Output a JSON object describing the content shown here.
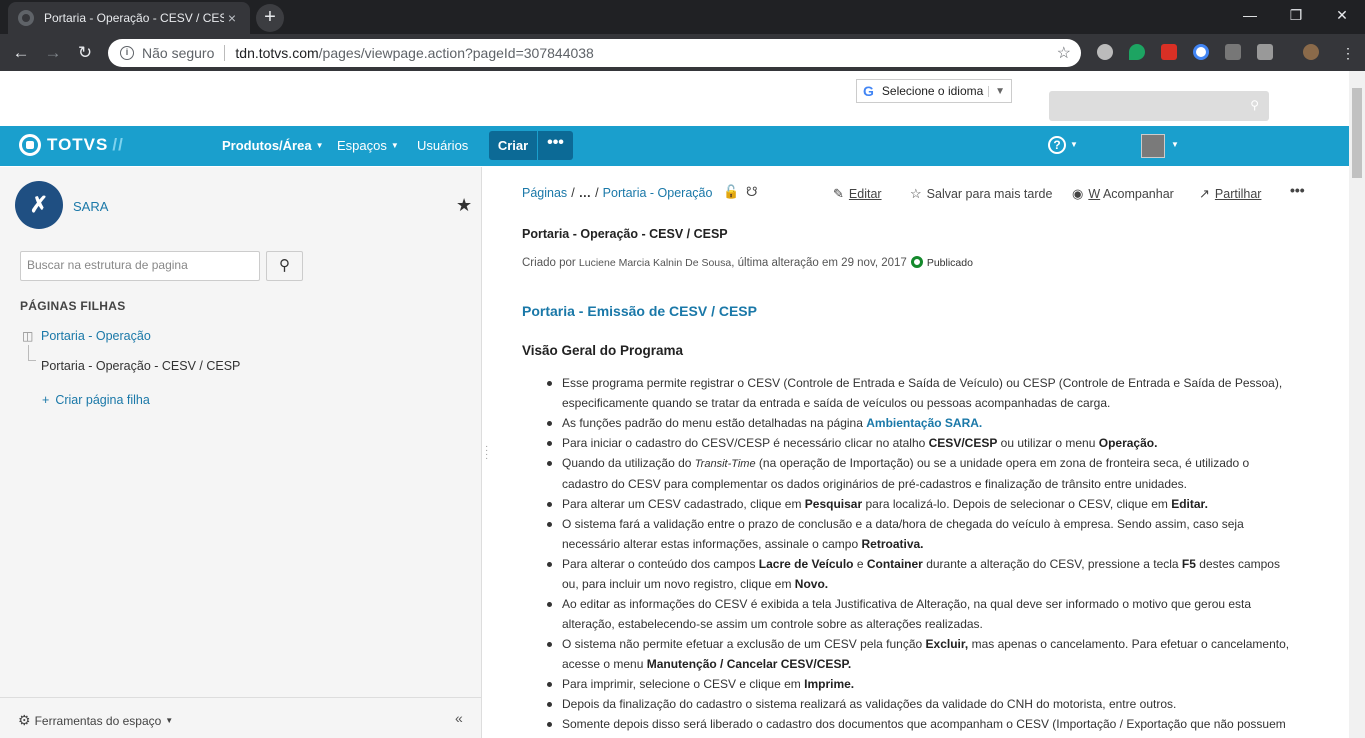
{
  "browser": {
    "tab_title": "Portaria - Operação - CESV / CES",
    "tab_close": "×",
    "new_tab": "+",
    "security_label": "Não seguro",
    "url_host": "tdn.totvs.com",
    "url_path": "/pages/viewpage.action?pageId=307844038"
  },
  "top": {
    "language_select": "Selecione o idioma"
  },
  "header": {
    "logo": "TOTVS",
    "logo_slash": "//",
    "nav": [
      "Produtos/Área",
      "Espaços",
      "Usuários"
    ],
    "create": "Criar",
    "more": "•••"
  },
  "sidebar": {
    "space_name": "SARA",
    "search_placeholder": "Buscar na estrutura de pagina",
    "child_pages_title": "PÁGINAS FILHAS",
    "tree": [
      "Portaria - Operação",
      "Portaria - Operação - CESV / CESP"
    ],
    "add_child": "Criar página filha",
    "tools": "Ferramentas do espaço"
  },
  "content": {
    "breadcrumbs": [
      "Páginas",
      "…",
      "Portaria - Operação"
    ],
    "actions": {
      "edit": "Editar",
      "save_later": "Salvar para mais tarde",
      "watch_key": "W",
      "watch": " Acompanhar",
      "share": "Partilhar"
    },
    "page_title": "Portaria - Operação - CESV / CESP",
    "meta_created_by": "Criado por ",
    "meta_author": "Luciene Marcia Kalnin De Sousa",
    "meta_last_change": ", última alteração em 29 nov, 2017",
    "meta_status": "Publicado",
    "heading": "Portaria - Emissão de CESV / CESP",
    "subheading": "Visão Geral do Programa",
    "bullets": [
      [
        "Esse programa permite registrar o CESV (Controle de Entrada e Saída de Veículo) ou CESP (Controle de Entrada e Saída de Pessoa), especificamente quando se tratar da entrada e saída de veículos ou pessoas acompanhadas de carga."
      ],
      [
        "As funções padrão do menu estão detalhadas na página ",
        "Ambientação SARA."
      ],
      [
        "Para iniciar o cadastro do CESV/CESP é necessário clicar no atalho ",
        "CESV/CESP",
        " ou utilizar o menu ",
        "Operação."
      ],
      [
        "Quando da utilização do ",
        "Transit-Time",
        " (na operação de Importação) ou se a unidade opera em zona de fronteira seca, é utilizado o cadastro do CESV para complementar os dados originários de pré-cadastros e finalização de trânsito entre unidades."
      ],
      [
        "Para alterar um CESV cadastrado, clique em ",
        "Pesquisar",
        " para localizá-lo. Depois de selecionar o CESV, clique em ",
        "Editar."
      ],
      [
        "O sistema fará a validação entre o prazo de conclusão e a data/hora de chegada do veículo à empresa. Sendo assim, caso seja necessário alterar estas informações, assinale o campo ",
        "Retroativa."
      ],
      [
        "Para alterar o conteúdo dos campos ",
        "Lacre de Veículo",
        " e ",
        "Container",
        " durante a alteração do CESV, pressione a tecla ",
        "F5",
        " destes campos ou, para incluir um novo registro, clique em ",
        "Novo."
      ],
      [
        "Ao editar as informações do CESV é exibida a tela Justificativa de Alteração, na qual deve ser informado o motivo que gerou esta alteração, estabelecendo-se assim um controle sobre as alterações realizadas."
      ],
      [
        "O sistema não permite efetuar a exclusão de um CESV pela função ",
        "Excluir,",
        " mas apenas o cancelamento. Para efetuar o cancelamento, acesse o menu ",
        "Manutenção / Cancelar CESV/CESP."
      ],
      [
        "Para imprimir, selecione o CESV e clique em ",
        "Imprime."
      ],
      [
        "Depois da finalização do cadastro o sistema realizará as validações da validade do CNH do motorista, entre outros."
      ],
      [
        "Somente depois disso será liberado o cadastro dos documentos que acompanham o CESV (Importação / Exportação que não possuem pré-"
      ]
    ]
  }
}
